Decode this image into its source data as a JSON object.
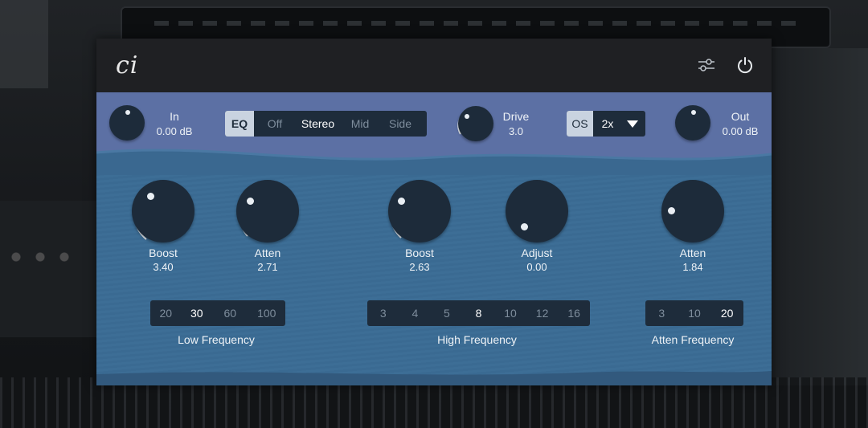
{
  "header": {
    "logo_text": "ci",
    "settings_icon": "sliders-icon",
    "power_icon": "power-icon"
  },
  "top": {
    "in": {
      "label": "In",
      "value": "0.00 dB"
    },
    "mode": {
      "eq_label": "EQ",
      "options": [
        "Off",
        "Stereo",
        "Mid",
        "Side"
      ],
      "selected": "Stereo"
    },
    "drive": {
      "label": "Drive",
      "value": "3.0"
    },
    "os": {
      "label": "OS",
      "value": "2x"
    },
    "out": {
      "label": "Out",
      "value": "0.00 dB"
    }
  },
  "knobs": {
    "low_boost": {
      "label": "Boost",
      "value": "3.40"
    },
    "low_atten": {
      "label": "Atten",
      "value": "2.71"
    },
    "high_boost": {
      "label": "Boost",
      "value": "2.63"
    },
    "high_adjust": {
      "label": "Adjust",
      "value": "0.00"
    },
    "atten": {
      "label": "Atten",
      "value": "1.84"
    }
  },
  "low_frequency": {
    "label": "Low Frequency",
    "options": [
      "20",
      "30",
      "60",
      "100"
    ],
    "selected": "30"
  },
  "high_frequency": {
    "label": "High Frequency",
    "options": [
      "3",
      "4",
      "5",
      "8",
      "10",
      "12",
      "16"
    ],
    "selected": "8"
  },
  "atten_frequency": {
    "label": "Atten Frequency",
    "options": [
      "3",
      "10",
      "20"
    ],
    "selected": "20"
  },
  "colors": {
    "panel": "#3c6b93",
    "band": "#5c70a4",
    "header": "#1f2023",
    "knob": "#1d2b3a"
  }
}
